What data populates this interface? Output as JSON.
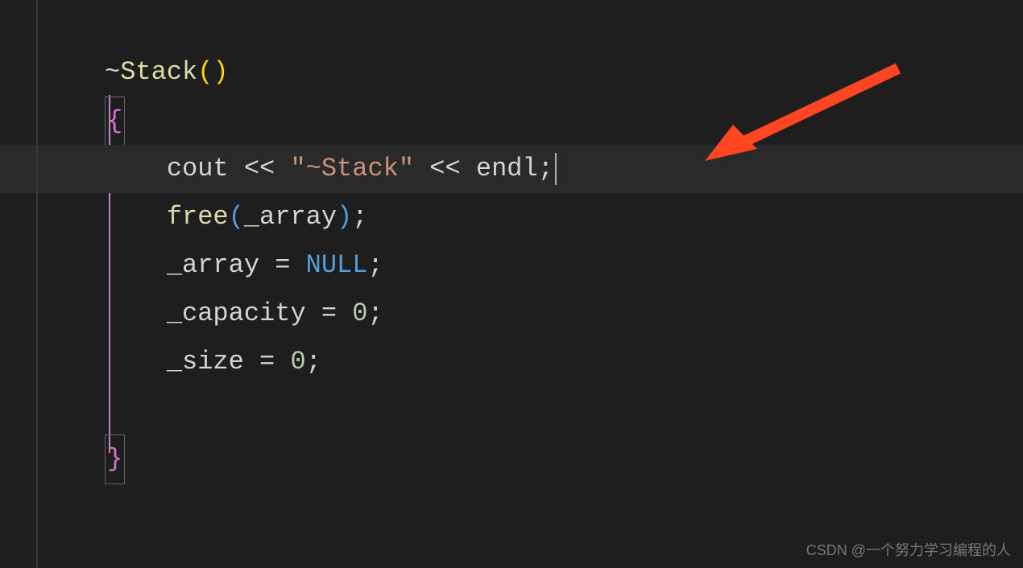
{
  "code": {
    "line1": {
      "tilde": "~",
      "name": "Stack",
      "parens": "()"
    },
    "line2": {
      "brace": "{"
    },
    "line3": {
      "indent": "    ",
      "cout": "cout",
      "op1": " << ",
      "str": "\"~Stack\"",
      "op2": " << ",
      "endl": "endl",
      "semi": ";"
    },
    "line4": {
      "indent": "    ",
      "free": "free",
      "lparen": "(",
      "arg": "_array",
      "rparen": ")",
      "semi": ";"
    },
    "line5": {
      "indent": "    ",
      "var": "_array",
      "eq": " = ",
      "val": "NULL",
      "semi": ";"
    },
    "line6": {
      "indent": "    ",
      "var": "_capacity",
      "eq": " = ",
      "val": "0",
      "semi": ";"
    },
    "line7": {
      "indent": "    ",
      "var": "_size",
      "eq": " = ",
      "val": "0",
      "semi": ";"
    },
    "line8": {
      "blank": ""
    },
    "line9": {
      "brace": "}"
    }
  },
  "watermark": "CSDN @一个努力学习编程的人"
}
